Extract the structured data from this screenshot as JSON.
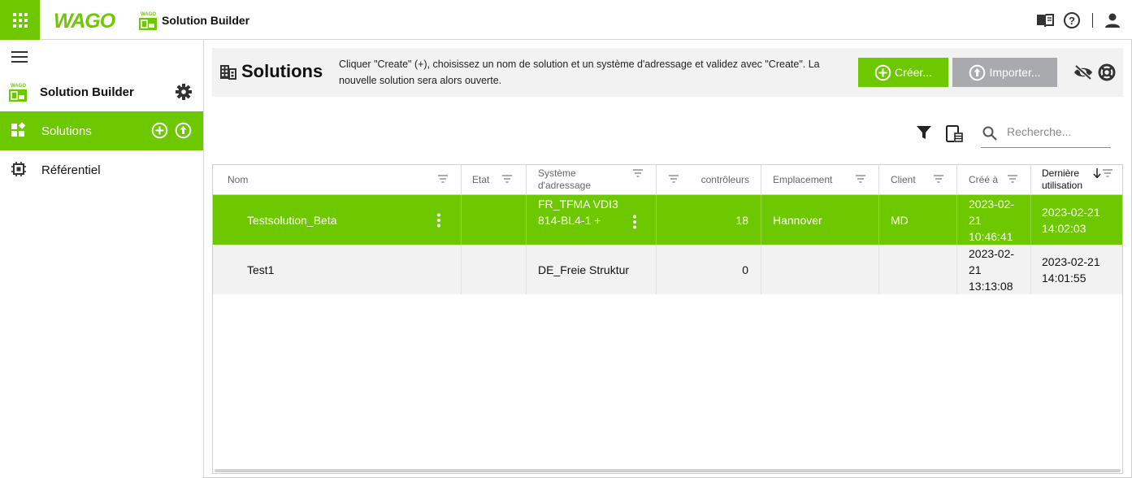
{
  "topbar": {
    "brand": "WAGO",
    "app_title": "Solution Builder"
  },
  "sidebar": {
    "header_label": "Solution Builder",
    "items": [
      {
        "label": "Solutions",
        "active": true
      },
      {
        "label": "Référentiel",
        "active": false
      }
    ]
  },
  "page": {
    "title": "Solutions",
    "hint": "Cliquer \"Create\" (+), choisissez un nom de solution et un système d'adressage et validez avec \"Create\". La nouvelle solution sera alors ouverte.",
    "create_label": "Créer...",
    "import_label": "Importer..."
  },
  "search": {
    "placeholder": "Recherche..."
  },
  "table": {
    "columns": [
      "Nom",
      "Etat",
      "Système d'adressage",
      "contrôleurs",
      "Emplacement",
      "Client",
      "Créé à",
      "Dernière utilisation"
    ],
    "rows": [
      {
        "name": "Testsolution_Beta",
        "state": "",
        "addressing": "FR_TFMA VDI3814-BL4-1 +",
        "controllers": "18",
        "location": "Hannover",
        "client": "MD",
        "created": "2023-02-21 10:46:41",
        "last_used": "2023-02-21 14:02:03",
        "selected": true
      },
      {
        "name": "Test1",
        "state": "",
        "addressing": "DE_Freie Struktur",
        "controllers": "0",
        "location": "",
        "client": "",
        "created": "2023-02-21 13:13:08",
        "last_used": "2023-02-21 14:01:55",
        "selected": false
      }
    ]
  },
  "colors": {
    "accent": "#6ec800",
    "button_disabled": "#a9aaad"
  }
}
